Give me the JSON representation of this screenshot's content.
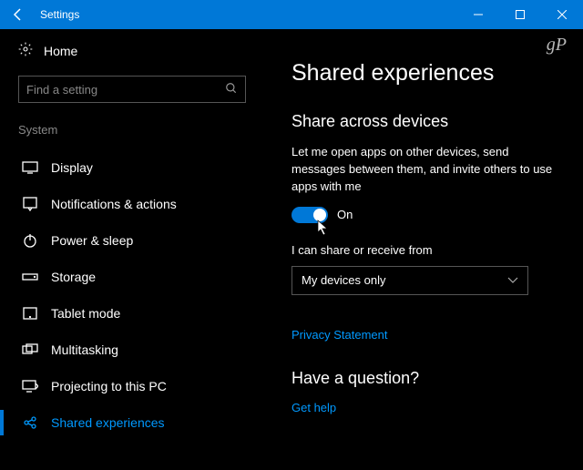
{
  "titlebar": {
    "app_title": "Settings"
  },
  "watermark": "gP",
  "sidebar": {
    "home_label": "Home",
    "search_placeholder": "Find a setting",
    "category_label": "System",
    "items": [
      {
        "label": "Display"
      },
      {
        "label": "Notifications & actions"
      },
      {
        "label": "Power & sleep"
      },
      {
        "label": "Storage"
      },
      {
        "label": "Tablet mode"
      },
      {
        "label": "Multitasking"
      },
      {
        "label": "Projecting to this PC"
      },
      {
        "label": "Shared experiences"
      }
    ]
  },
  "main": {
    "page_title": "Shared experiences",
    "section_title": "Share across devices",
    "description": "Let me open apps on other devices, send messages between them, and invite others to use apps with me",
    "toggle_state": "On",
    "share_from_label": "I can share or receive from",
    "share_from_value": "My devices only",
    "privacy_link": "Privacy Statement",
    "help_title": "Have a question?",
    "help_link": "Get help"
  }
}
